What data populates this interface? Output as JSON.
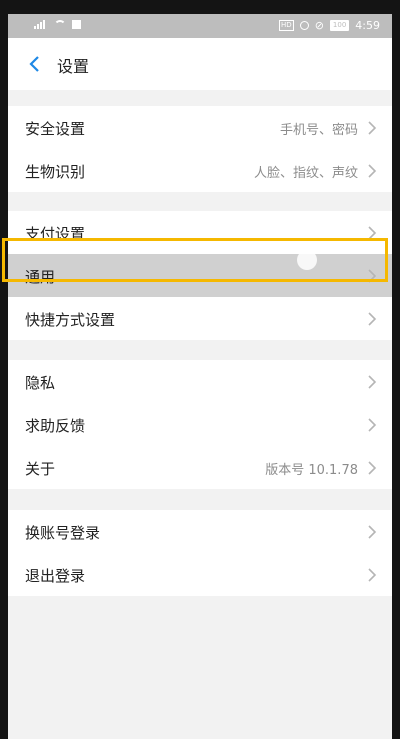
{
  "status_bar": {
    "battery": "100",
    "time": "4:59"
  },
  "header": {
    "title": "设置"
  },
  "groups": [
    [
      {
        "label": "安全设置",
        "value": "手机号、密码"
      },
      {
        "label": "生物识别",
        "value": "人脸、指纹、声纹"
      }
    ],
    [
      {
        "label": "支付设置",
        "value": ""
      },
      {
        "label": "通用",
        "value": "",
        "highlighted": true
      },
      {
        "label": "快捷方式设置",
        "value": ""
      }
    ],
    [
      {
        "label": "隐私",
        "value": ""
      },
      {
        "label": "求助反馈",
        "value": ""
      },
      {
        "label": "关于",
        "value": "版本号 10.1.78"
      }
    ],
    [
      {
        "label": "换账号登录",
        "value": ""
      },
      {
        "label": "退出登录",
        "value": ""
      }
    ]
  ],
  "icons": {
    "back": "chevron-left-icon",
    "row_arrow": "chevron-right-icon"
  },
  "colors": {
    "accent": "#1e88e5",
    "highlight_border": "#f5b800",
    "status_bar": "#bdbdbd"
  }
}
